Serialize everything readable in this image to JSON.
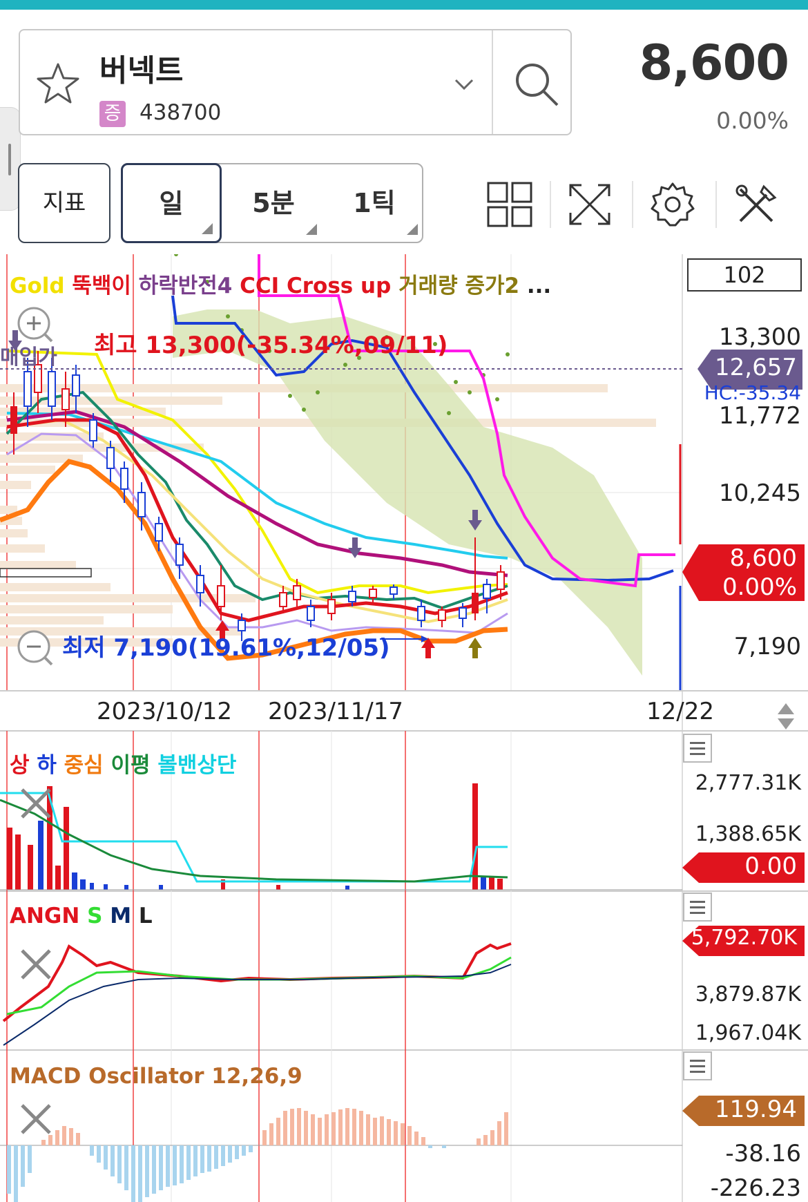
{
  "header": {
    "stock_name": "버넥트",
    "market_badge": "증",
    "stock_code": "438700",
    "price": "8,600",
    "change_pct": "0.00%"
  },
  "toolbar": {
    "indicator_btn": "지표",
    "periods": [
      "일",
      "5분",
      "1틱"
    ],
    "active_period": "일",
    "icons": [
      "grid-layout-icon",
      "expand-icon",
      "gear-icon",
      "tools-icon"
    ]
  },
  "main_chart": {
    "signals": [
      {
        "label": "Gold",
        "color": "#f2e000"
      },
      {
        "label": "뚝백이",
        "color": "#e0141e"
      },
      {
        "label": "하락반전4",
        "color": "#7a3f8c"
      },
      {
        "label": "CCI Cross up",
        "color": "#e0141e"
      },
      {
        "label": "거래량 증가2",
        "color": "#8a7a10"
      },
      {
        "label": "...",
        "color": "#222222"
      }
    ],
    "period_count": "102",
    "high_note": "최고 13,300(-35.34%,09/11)",
    "low_note": "최저 7,190(19.61%,12/05)",
    "buy_price_label": "매입가",
    "axis_labels": [
      "13,300",
      "11,772",
      "10,245",
      "7,190"
    ],
    "avg_tag": "12,657",
    "hc_label": "HC:-35.34",
    "current_price_tag": "8,600",
    "current_pct_tag": "0.00%",
    "dates": [
      "2023/10/12",
      "2023/11/17",
      "12/22"
    ]
  },
  "volume_panel": {
    "legend": [
      {
        "label": "상",
        "color": "#e0141e"
      },
      {
        "label": "하",
        "color": "#1a3fd6"
      },
      {
        "label": "중심",
        "color": "#f07a10"
      },
      {
        "label": "이평",
        "color": "#1a8a3a"
      },
      {
        "label": "볼밴상단",
        "color": "#10d0e0"
      }
    ],
    "axis_labels": [
      "2,777.31K",
      "1,388.65K"
    ],
    "current_tag": "0.00"
  },
  "angn_panel": {
    "legend": [
      {
        "label": "ANGN",
        "color": "#e0141e"
      },
      {
        "label": "S",
        "color": "#33dd33"
      },
      {
        "label": "M",
        "color": "#0a2a6a"
      },
      {
        "label": "L",
        "color": "#222222"
      }
    ],
    "current_tag": "5,792.70K",
    "axis_labels": [
      "3,879.87K",
      "1,967.04K"
    ]
  },
  "macd_panel": {
    "legend": "MACD Oscillator 12,26,9",
    "current_tag": "119.94",
    "axis_labels": [
      "-38.16",
      "-226.23"
    ]
  },
  "colors": {
    "accent": "#1fb3c0",
    "up_red": "#e0141e",
    "down_blue": "#1a3fd6",
    "avg_purple": "#6a5a8e",
    "macd_brown": "#b86a2a"
  }
}
